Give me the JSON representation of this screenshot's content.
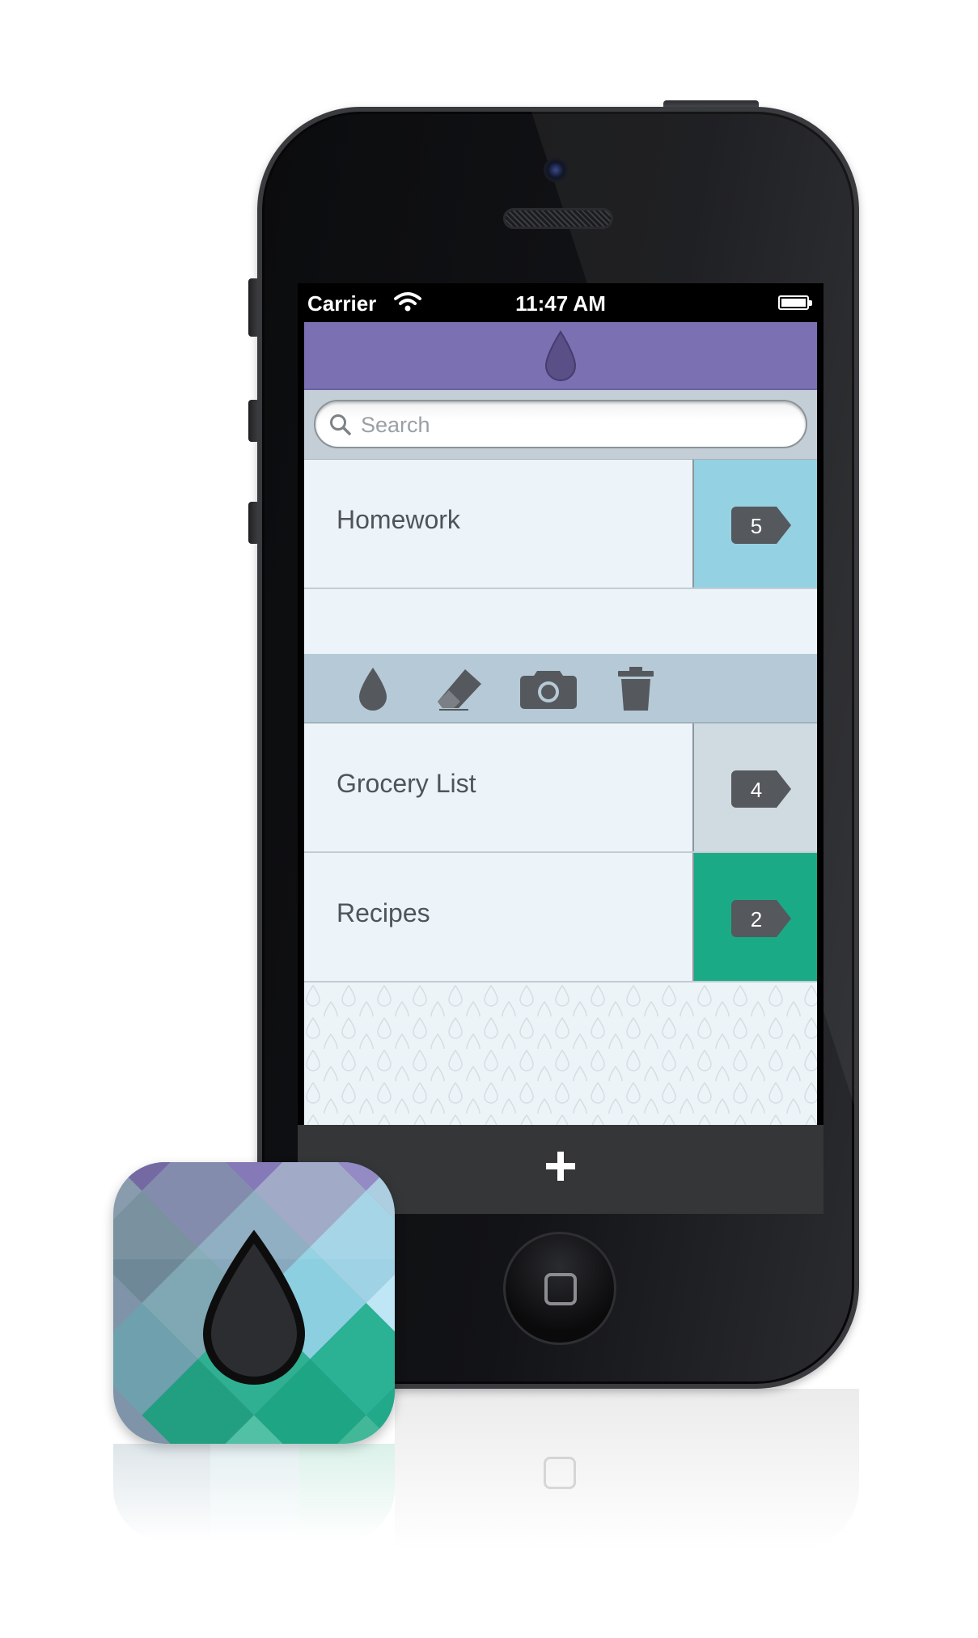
{
  "status_bar": {
    "carrier": "Carrier",
    "time": "11:47 AM",
    "wifi_icon": "wifi-icon",
    "battery_icon": "battery-icon"
  },
  "nav_bar": {
    "logo_icon": "drop-icon",
    "color": "#7b70b1"
  },
  "search": {
    "placeholder": "Search",
    "value": ""
  },
  "lists": [
    {
      "title": "Homework",
      "count": "5",
      "color": "#94d1e2"
    },
    {
      "title": "Grocery List",
      "count": "4",
      "color": "#d0dbe1"
    },
    {
      "title": "Recipes",
      "count": "2",
      "color": "#1aab86"
    }
  ],
  "action_bar": {
    "actions": [
      "drop-icon",
      "eraser-icon",
      "camera-icon",
      "trash-icon"
    ]
  },
  "bottom_bar": {
    "add_label": "+"
  },
  "colors": {
    "purple": "#7b70b1",
    "blue": "#94d1e2",
    "gray": "#d0dbe1",
    "green": "#1aab86",
    "icon_dark": "#55595d"
  }
}
